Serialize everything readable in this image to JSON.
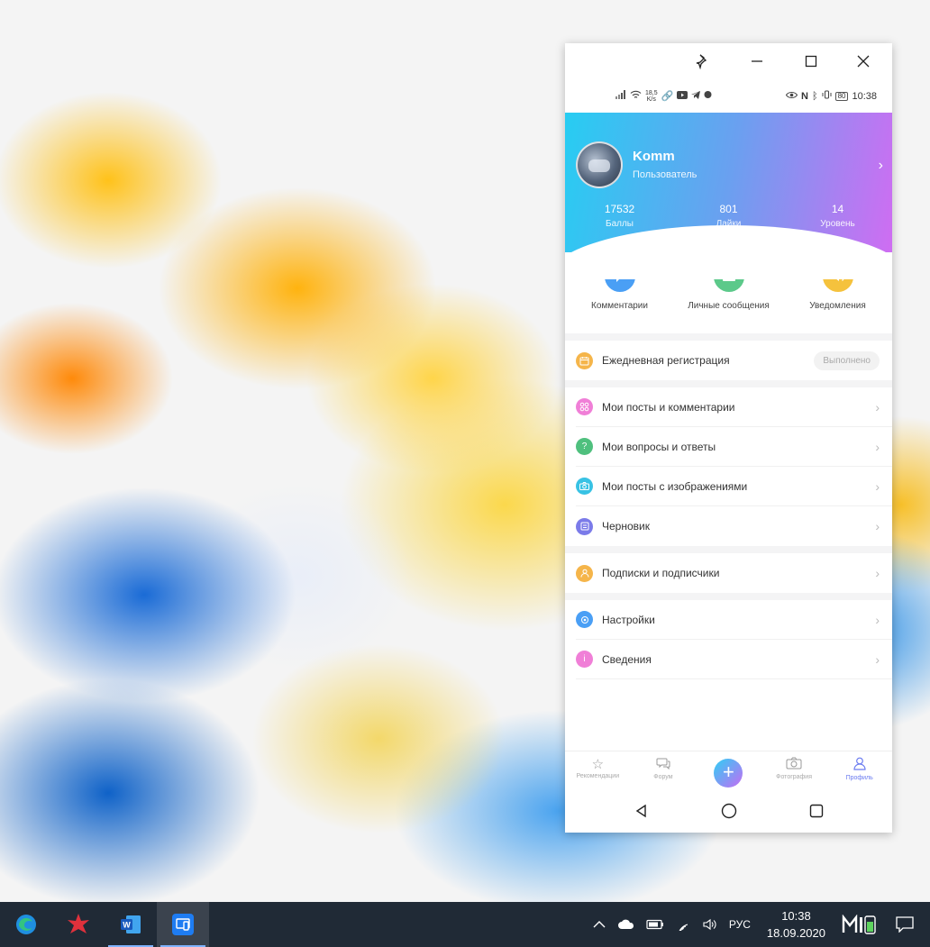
{
  "titlebar": {
    "pin_icon": "pin-icon",
    "minimize_icon": "minimize-icon",
    "maximize_icon": "maximize-icon",
    "close_icon": "close-icon"
  },
  "statusbar": {
    "speed_value": "18,5",
    "speed_unit": "K/s",
    "battery": "80",
    "time": "10:38"
  },
  "profile": {
    "name": "Komm",
    "role": "Пользователь",
    "stats": [
      {
        "value": "17532",
        "label": "Баллы"
      },
      {
        "value": "801",
        "label": "Лайки"
      },
      {
        "value": "14",
        "label": "Уровень"
      }
    ]
  },
  "quick_actions": [
    {
      "label": "Комментарии",
      "icon": "comment-icon",
      "color": "#4a9ff5"
    },
    {
      "label": "Личные сообщения",
      "icon": "mail-icon",
      "color": "#5cc98a"
    },
    {
      "label": "Уведомления",
      "icon": "speaker-icon",
      "color": "#f5c23d"
    }
  ],
  "daily": {
    "label": "Ежедневная регистрация",
    "status": "Выполнено",
    "color": "#f5b54a"
  },
  "menu_group_1": [
    {
      "label": "Мои посты и комментарии",
      "color": "#f07fd7",
      "icon": "grid-icon"
    },
    {
      "label": "Мои вопросы и ответы",
      "color": "#4fc07e",
      "icon": "question-icon"
    },
    {
      "label": "Мои посты с изображениями",
      "color": "#38c2e4",
      "icon": "camera-icon"
    },
    {
      "label": "Черновик",
      "color": "#7b7be9",
      "icon": "draft-icon"
    }
  ],
  "menu_group_2": [
    {
      "label": "Подписки и подписчики",
      "color": "#f5b54a",
      "icon": "user-icon"
    }
  ],
  "menu_group_3": [
    {
      "label": "Настройки",
      "color": "#4a9ff5",
      "icon": "settings-icon"
    },
    {
      "label": "Сведения",
      "color": "#f07fd7",
      "icon": "info-icon"
    }
  ],
  "bottom_nav": [
    {
      "label": "Рекомендации",
      "icon": "star-icon",
      "active": false
    },
    {
      "label": "Форум",
      "icon": "forum-icon",
      "active": false
    },
    {
      "label": "",
      "icon": "plus-icon",
      "active": false
    },
    {
      "label": "Фотография",
      "icon": "camera-icon",
      "active": false
    },
    {
      "label": "Профиль",
      "icon": "profile-icon",
      "active": true
    }
  ],
  "taskbar": {
    "lang": "РУС",
    "time": "10:38",
    "date": "18.09.2020"
  }
}
